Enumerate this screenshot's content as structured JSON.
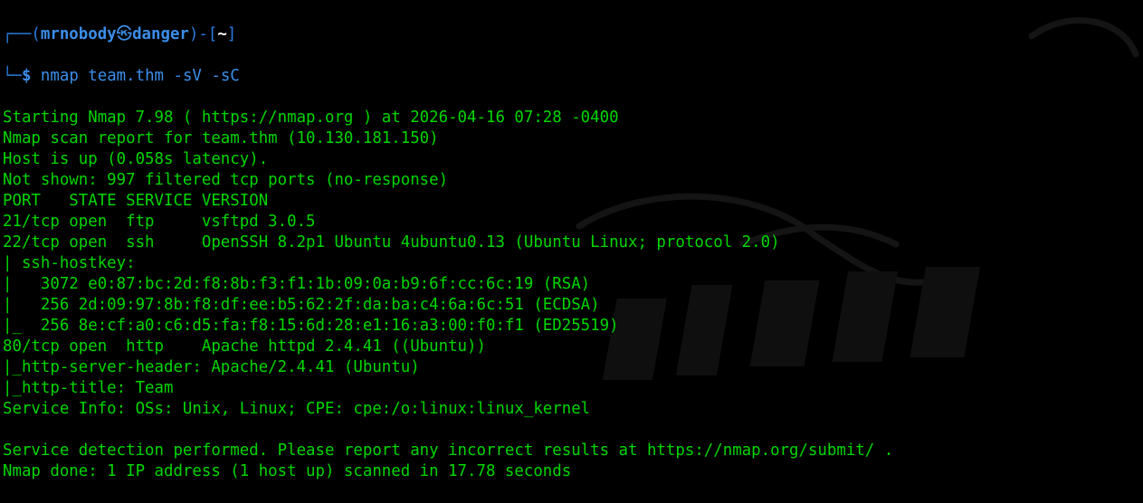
{
  "colors": {
    "background": "#000000",
    "output": "#00d600",
    "prompt": "#3b8eea",
    "cwd": "#ffffff"
  },
  "prompt": {
    "user": "mrnobody",
    "at_symbol": "㉿",
    "host": "danger",
    "cwd": "~",
    "command": "nmap team.thm -sV -sC"
  },
  "output_lines": [
    "Starting Nmap 7.98 ( https://nmap.org ) at 2026-04-16 07:28 -0400",
    "Nmap scan report for team.thm (10.130.181.150)",
    "Host is up (0.058s latency).",
    "Not shown: 997 filtered tcp ports (no-response)",
    "PORT   STATE SERVICE VERSION",
    "21/tcp open  ftp     vsftpd 3.0.5",
    "22/tcp open  ssh     OpenSSH 8.2p1 Ubuntu 4ubuntu0.13 (Ubuntu Linux; protocol 2.0)",
    "| ssh-hostkey: ",
    "|   3072 e0:87:bc:2d:f8:8b:f3:f1:1b:09:0a:b9:6f:cc:6c:19 (RSA)",
    "|   256 2d:09:97:8b:f8:df:ee:b5:62:2f:da:ba:c4:6a:6c:51 (ECDSA)",
    "|_  256 8e:cf:a0:c6:d5:fa:f8:15:6d:28:e1:16:a3:00:f0:f1 (ED25519)",
    "80/tcp open  http    Apache httpd 2.4.41 ((Ubuntu))",
    "|_http-server-header: Apache/2.4.41 (Ubuntu)",
    "|_http-title: Team",
    "Service Info: OSs: Unix, Linux; CPE: cpe:/o:linux:linux_kernel",
    "",
    "Service detection performed. Please report any incorrect results at https://nmap.org/submit/ .",
    "Nmap done: 1 IP address (1 host up) scanned in 17.78 seconds"
  ]
}
